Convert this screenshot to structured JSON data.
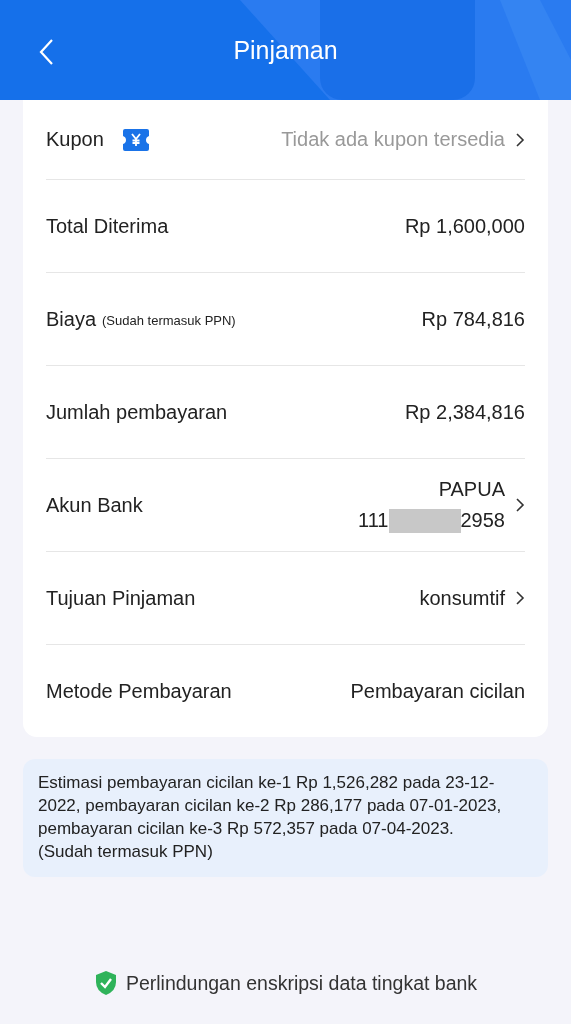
{
  "header": {
    "title": "Pinjaman"
  },
  "rows": [
    {
      "kind": "coupon",
      "label": "Kupon",
      "value": "Tidak ada kupon tersedia",
      "chevron": true
    },
    {
      "kind": "plain",
      "label": "Total Diterima",
      "value": "Rp 1,600,000"
    },
    {
      "kind": "plain",
      "label": "Biaya",
      "note": "(Sudah termasuk PPN)",
      "value": "Rp 784,816"
    },
    {
      "kind": "plain",
      "label": "Jumlah pembayaran",
      "value": "Rp 2,384,816"
    },
    {
      "kind": "account",
      "label": "Akun Bank",
      "bank": "PAPUA",
      "account_start": "111",
      "account_end": "2958",
      "chevron": true
    },
    {
      "kind": "plain",
      "label": "Tujuan Pinjaman",
      "value": "konsumtif",
      "chevron": true
    },
    {
      "kind": "plain",
      "label": "Metode Pembayaran",
      "value": "Pembayaran cicilan"
    }
  ],
  "info": "Estimasi pembayaran cicilan ke-1 Rp 1,526,282 pada 23-12-2022, pembayaran cicilan ke-2 Rp 286,177 pada 07-01-2023, pembayaran cicilan ke-3 Rp 572,357 pada 07-04-2023. (Sudah termasuk PPN)",
  "footer": "Perlindungan enskripsi data tingkat bank"
}
